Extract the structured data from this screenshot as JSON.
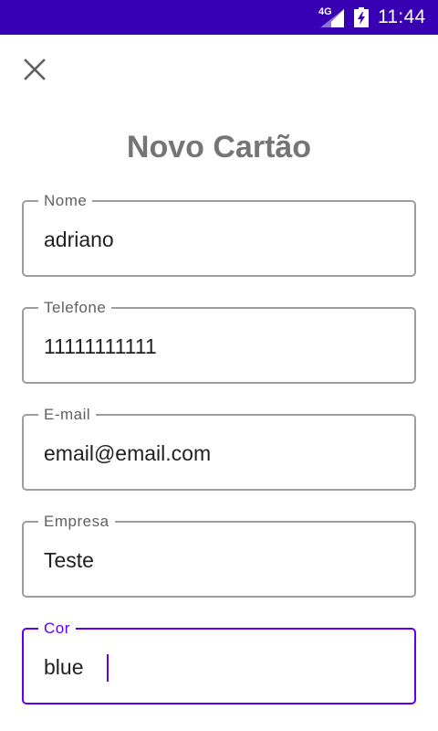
{
  "status_bar": {
    "network": "4G",
    "time": "11:44",
    "background": "#3700b3",
    "icons": [
      "signal-icon",
      "battery-charging-icon"
    ]
  },
  "toolbar": {
    "close_icon": "close-icon"
  },
  "title": "Novo Cartão",
  "form": {
    "fields": [
      {
        "label": "Nome",
        "value": "adriano"
      },
      {
        "label": "Telefone",
        "value": "11111111111"
      },
      {
        "label": "E-mail",
        "value": "email@email.com"
      },
      {
        "label": "Empresa",
        "value": "Teste"
      },
      {
        "label": "Cor",
        "value": "blue"
      }
    ],
    "focused_field": "Cor"
  },
  "colors": {
    "accent": "#6200ee",
    "outline": "#9e9e9e",
    "title": "#757575"
  }
}
